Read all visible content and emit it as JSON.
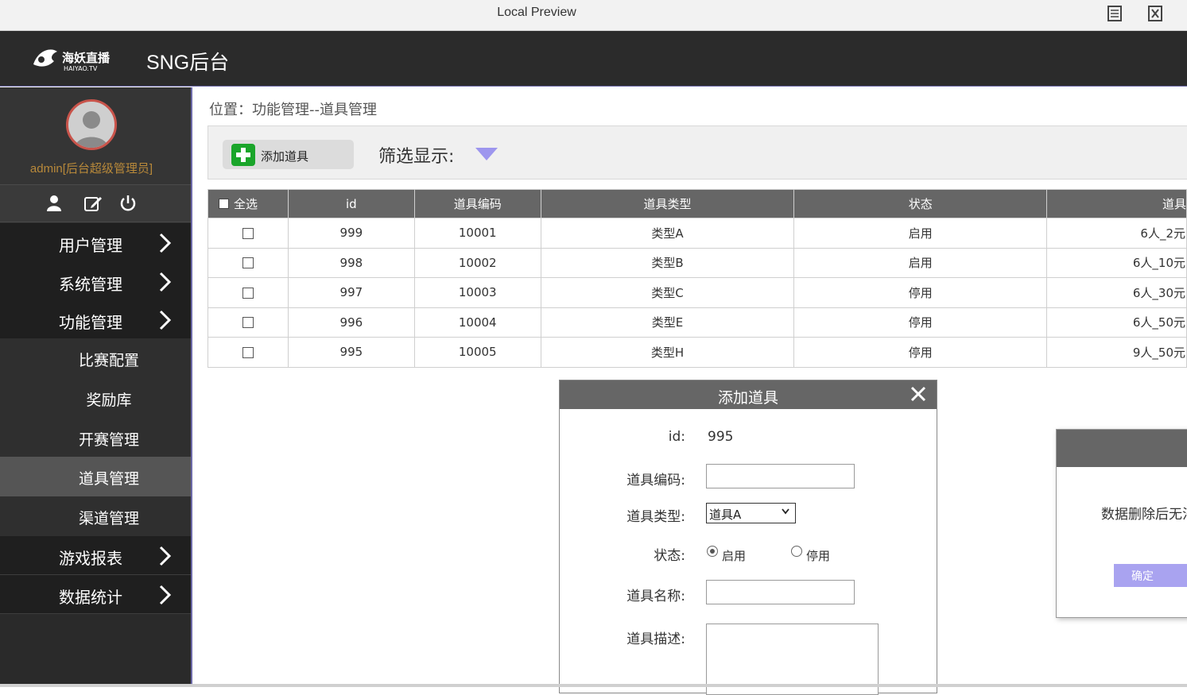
{
  "window": {
    "title": "Local Preview"
  },
  "header": {
    "logo_text": "海妖直播 HAIYAO.TV",
    "app_title": "SNG后台"
  },
  "sidebar": {
    "admin_name": "admin[后台超级管理员]",
    "tool_icons": [
      "user-icon",
      "edit-icon",
      "power-icon"
    ],
    "nav": [
      {
        "label": "用户管理",
        "type": "main"
      },
      {
        "label": "系统管理",
        "type": "main"
      },
      {
        "label": "功能管理",
        "type": "main"
      },
      {
        "label": "比赛配置",
        "type": "sub"
      },
      {
        "label": "奖励库",
        "type": "sub"
      },
      {
        "label": "开赛管理",
        "type": "sub"
      },
      {
        "label": "道具管理",
        "type": "sub",
        "active": true
      },
      {
        "label": "渠道管理",
        "type": "sub"
      },
      {
        "label": "游戏报表",
        "type": "main"
      },
      {
        "label": "数据统计",
        "type": "main"
      }
    ]
  },
  "main": {
    "breadcrumb": "位置：功能管理--道具管理",
    "add_button": "添加道具",
    "filter_label": "筛选显示:",
    "table": {
      "select_all": "全选",
      "columns": [
        "id",
        "道具编码",
        "道具类型",
        "状态",
        "道具"
      ],
      "rows": [
        [
          "999",
          "10001",
          "类型A",
          "启用",
          "6人_2元"
        ],
        [
          "998",
          "10002",
          "类型B",
          "启用",
          "6人_10元"
        ],
        [
          "997",
          "10003",
          "类型C",
          "停用",
          "6人_30元"
        ],
        [
          "996",
          "10004",
          "类型E",
          "停用",
          "6人_50元"
        ],
        [
          "995",
          "10005",
          "类型H",
          "停用",
          "9人_50元"
        ]
      ]
    }
  },
  "dialog": {
    "title": "添加道具",
    "id_label": "id:",
    "id_value": "995",
    "code_label": "道具编码:",
    "type_label": "道具类型:",
    "type_selected": "道具A",
    "status_label": "状态:",
    "status_on": "启用",
    "status_off": "停用",
    "name_label": "道具名称:",
    "desc_label": "道具描述:"
  },
  "confirm": {
    "message": "数据删除后无法",
    "ok": "确定"
  },
  "colors": {
    "header_bg": "#2b2b2b",
    "accent": "#a9a3f0",
    "add_icon": "#1aa52a",
    "avatar_ring": "#c9544b",
    "admin_text": "#b8893a"
  }
}
